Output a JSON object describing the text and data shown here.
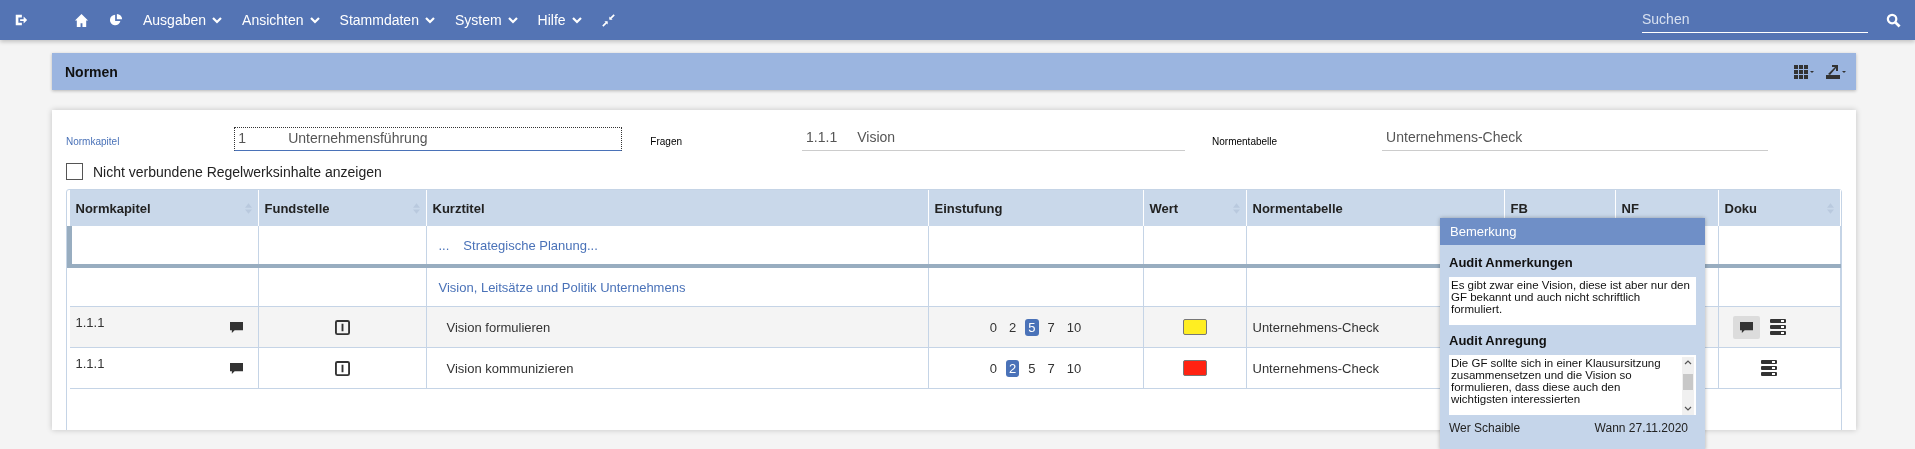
{
  "navbar": {
    "menus": [
      {
        "label": "Ausgaben"
      },
      {
        "label": "Ansichten"
      },
      {
        "label": "Stammdaten"
      },
      {
        "label": "System"
      },
      {
        "label": "Hilfe"
      }
    ],
    "search": {
      "placeholder": "Suchen"
    }
  },
  "panel": {
    "title": "Normen"
  },
  "filters": [
    {
      "label": "Normkapitel",
      "number": "1",
      "value": "Unternehmensführung",
      "focused": true
    },
    {
      "label": "Fragen",
      "number": "1.1.1",
      "value": "Vision",
      "focused": false
    },
    {
      "label": "Normentabelle",
      "value": "Unternehmens-Check",
      "focused": false
    }
  ],
  "checkbox": {
    "label": "Nicht verbundene Regelwerksinhalte anzeigen",
    "checked": false
  },
  "table": {
    "columns": [
      {
        "label": "Normkapitel",
        "sortable": true
      },
      {
        "label": "Fundstelle",
        "sortable": true
      },
      {
        "label": "Kurztitel",
        "sortable": false
      },
      {
        "label": "Einstufung",
        "sortable": false
      },
      {
        "label": "Wert",
        "sortable": true
      },
      {
        "label": "Normentabelle",
        "sortable": false
      },
      {
        "label": "FB",
        "sortable": false
      },
      {
        "label": "NF",
        "sortable": false
      },
      {
        "label": "Doku",
        "sortable": true
      }
    ],
    "rows": [
      {
        "kind": "group",
        "prefix": "...",
        "title": "Strategische Planung...",
        "current": true
      },
      {
        "kind": "group",
        "title": "Vision, Leitsätze und Politik Unternehmens",
        "current": false
      },
      {
        "kind": "item",
        "chapter": "1.1.1",
        "title": "Vision formulieren",
        "ratings": [
          {
            "label": "0",
            "selected": false
          },
          {
            "label": "2",
            "selected": false
          },
          {
            "label": "5",
            "selected": true
          },
          {
            "label": "7",
            "selected": false
          },
          {
            "label": "10",
            "selected": false
          }
        ],
        "color": "#ffee22",
        "table": "Unternehmens-Check",
        "comment_active": true,
        "hovered": true
      },
      {
        "kind": "item",
        "chapter": "1.1.1",
        "title": "Vision kommunizieren",
        "ratings": [
          {
            "label": "0",
            "selected": false
          },
          {
            "label": "2",
            "selected": true
          },
          {
            "label": "5",
            "selected": false
          },
          {
            "label": "7",
            "selected": false
          },
          {
            "label": "10",
            "selected": false
          }
        ],
        "color": "#ff2211",
        "table": "Unternehmens-Check",
        "comment_active": false,
        "hovered": false
      }
    ]
  },
  "popover": {
    "title": "Bemerkung",
    "sections": [
      {
        "heading": "Audit Anmerkungen",
        "text": "Es gibt zwar eine Vision, diese ist aber nur den GF bekannt und auch nicht schriftlich formuliert.",
        "scrollable": false
      },
      {
        "heading": "Audit Anregung",
        "text": "Die GF sollte sich in einer Klausursitzung zusammensetzen und die Vision so formulieren, dass diese auch den wichtigsten interessierten",
        "scrollable": true
      }
    ],
    "who": "Wer Schaible",
    "when": "Wann 27.11.2020"
  }
}
